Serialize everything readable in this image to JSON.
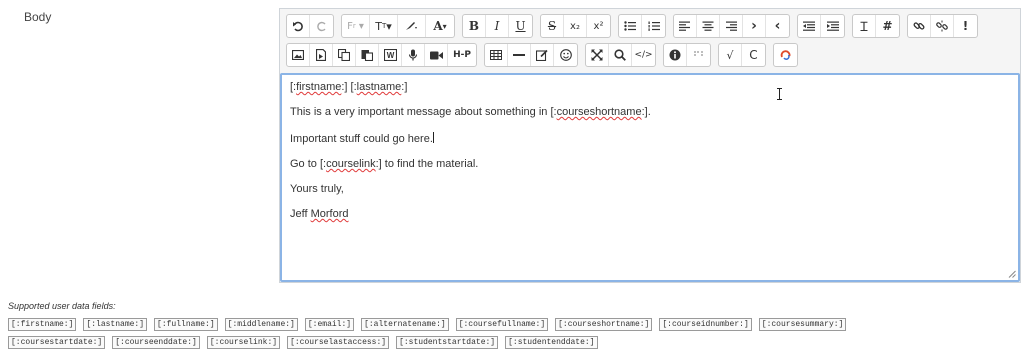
{
  "field_label": "Body",
  "toolbar": {
    "row1": [
      {
        "icon": "undo-icon",
        "glyph": "↶"
      },
      {
        "icon": "redo-icon",
        "glyph": "↷"
      },
      {
        "icon": "font-family-icon",
        "glyph": "Fᵣ ▾"
      },
      {
        "icon": "font-size-icon",
        "glyph": "T꜀ ▾"
      },
      {
        "icon": "paint-brush-icon",
        "glyph": "🖌▾"
      },
      {
        "icon": "font-color-icon",
        "glyph": "A ▾"
      },
      {
        "icon": "bold-icon",
        "glyph": "B"
      },
      {
        "icon": "italic-icon",
        "glyph": "I"
      },
      {
        "icon": "underline-icon",
        "glyph": "U"
      },
      {
        "icon": "strikethrough-icon",
        "glyph": "S"
      },
      {
        "icon": "subscript-icon",
        "glyph": "x₂"
      },
      {
        "icon": "superscript-icon",
        "glyph": "x²"
      },
      {
        "icon": "unordered-list-icon",
        "glyph": "☰"
      },
      {
        "icon": "ordered-list-icon",
        "glyph": "≡"
      },
      {
        "icon": "align-left-icon",
        "glyph": "≡"
      },
      {
        "icon": "align-center-icon",
        "glyph": "≡"
      },
      {
        "icon": "align-right-icon",
        "glyph": "≡"
      },
      {
        "icon": "ltr-icon",
        "glyph": "›"
      },
      {
        "icon": "rtl-icon",
        "glyph": "‹"
      },
      {
        "icon": "outdent-icon",
        "glyph": "⇤"
      },
      {
        "icon": "indent-icon",
        "glyph": "⇥"
      },
      {
        "icon": "clear-formatting-icon",
        "glyph": "Ɪ"
      },
      {
        "icon": "equation-icon",
        "glyph": "#"
      },
      {
        "icon": "link-icon",
        "glyph": "🔗"
      },
      {
        "icon": "unlink-icon",
        "glyph": "⛓"
      },
      {
        "icon": "important-icon",
        "glyph": "!"
      }
    ],
    "row2": [
      {
        "icon": "image-icon",
        "glyph": "▣"
      },
      {
        "icon": "media-icon",
        "glyph": "▤"
      },
      {
        "icon": "copy-icon",
        "glyph": "⧉"
      },
      {
        "icon": "paste-icon",
        "glyph": "📋"
      },
      {
        "icon": "paste-word-icon",
        "glyph": "W"
      },
      {
        "icon": "record-audio-icon",
        "glyph": "🎤"
      },
      {
        "icon": "record-video-icon",
        "glyph": "■"
      },
      {
        "icon": "h5p-icon",
        "glyph": "H-P"
      },
      {
        "icon": "table-icon",
        "glyph": "▦"
      },
      {
        "icon": "horizontal-rule-icon",
        "glyph": "—"
      },
      {
        "icon": "edit-icon",
        "glyph": "✎"
      },
      {
        "icon": "emoji-icon",
        "glyph": "☺"
      },
      {
        "icon": "fullscreen-icon",
        "glyph": "✛"
      },
      {
        "icon": "search-replace-icon",
        "glyph": "⌕"
      },
      {
        "icon": "html-icon",
        "glyph": "</>"
      },
      {
        "icon": "accessibility-icon",
        "glyph": "ⓘ"
      },
      {
        "icon": "screenreader-icon",
        "glyph": "⠿"
      },
      {
        "icon": "checkmark-icon",
        "glyph": "√"
      },
      {
        "icon": "refresh-icon",
        "glyph": "C"
      },
      {
        "icon": "spell-check-icon",
        "glyph": "⟲"
      }
    ]
  },
  "content": {
    "line1_a": "[:",
    "line1_b": "firstname",
    "line1_c": ":] [:",
    "line1_d": "lastname",
    "line1_e": ":]",
    "line2_a": "This is a very important message about something in [:",
    "line2_b": "courseshortname",
    "line2_c": ":].",
    "line3": "Important stuff could go here.",
    "line4_a": "Go to [:",
    "line4_b": "courselink",
    "line4_c": ":] to find the material.",
    "line5": "Yours truly,",
    "line6_a": "Jeff ",
    "line6_b": "Morford"
  },
  "supported_label": "Supported user data fields:",
  "tags_row1": [
    "[:firstname:]",
    "[:lastname:]",
    "[:fullname:]",
    "[:middlename:]",
    "[:email:]",
    "[:alternatename:]",
    "[:coursefullname:]",
    "[:courseshortname:]",
    "[:courseidnumber:]",
    "[:coursesummary:]"
  ],
  "tags_row2": [
    "[:coursestartdate:]",
    "[:courseenddate:]",
    "[:courselink:]",
    "[:courselastaccess:]",
    "[:studentstartdate:]",
    "[:studentenddate:]"
  ]
}
